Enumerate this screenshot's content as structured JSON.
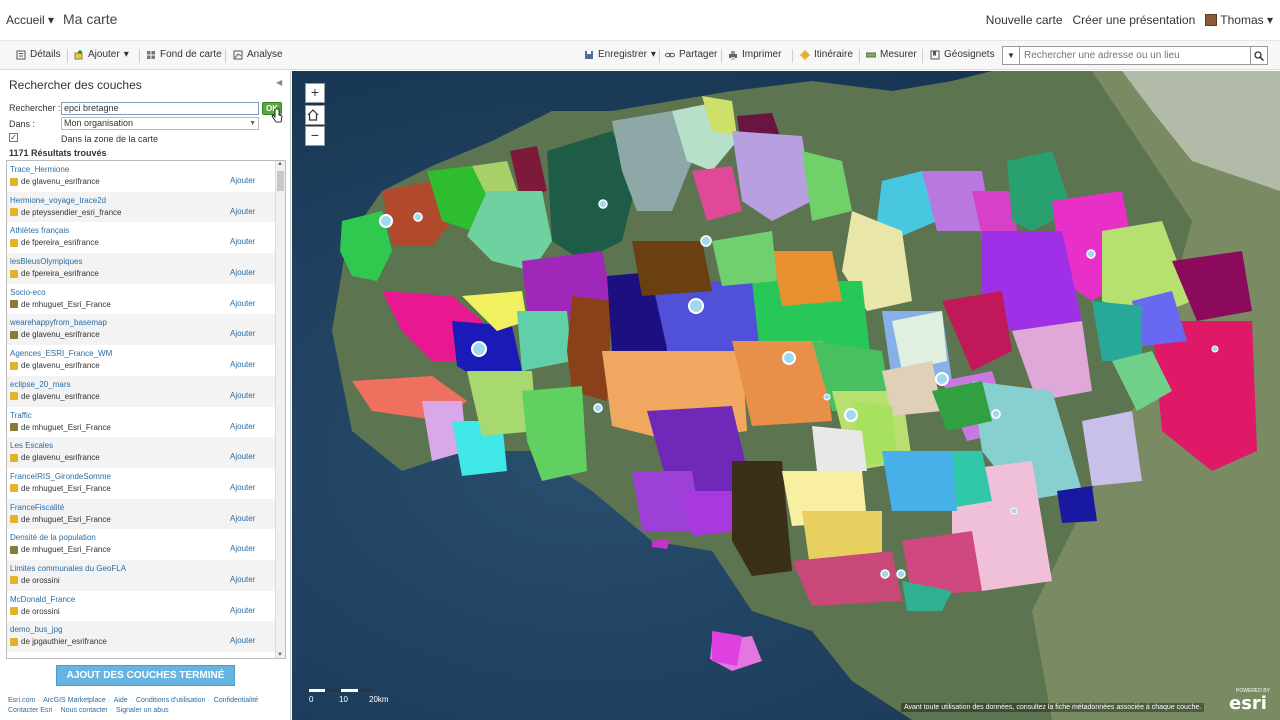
{
  "topnav": {
    "home": "Accueil",
    "map_title": "Ma carte",
    "new_map": "Nouvelle carte",
    "create_presentation": "Créer une présentation",
    "user": "Thomas"
  },
  "toolbar": {
    "details": "Détails",
    "add": "Ajouter",
    "basemap": "Fond de carte",
    "analysis": "Analyse",
    "save": "Enregistrer",
    "share": "Partager",
    "print": "Imprimer",
    "directions": "Itinéraire",
    "measure": "Mesurer",
    "bookmarks": "Géosignets",
    "search_placeholder": "Rechercher une adresse ou un lieu"
  },
  "panel": {
    "title": "Rechercher des couches",
    "search_label": "Rechercher :",
    "search_value": "epci bretagne",
    "ok": "OK",
    "in_label": "Dans :",
    "in_value": "Mon organisation",
    "extent_label": "Dans la zone de la carte",
    "results_count": "1171 Résultats trouvés",
    "add_label": "Ajouter",
    "results": [
      {
        "name": "Trace_Hermione",
        "owner": "de glavenu_esrifrance",
        "icon": "pin-icon"
      },
      {
        "name": "Hermione_voyage_trace2d",
        "owner": "de pteyssendier_esri_france",
        "icon": "pin-icon"
      },
      {
        "name": "Athlètes français",
        "owner": "de fpereira_esrifrance",
        "icon": "pin-icon"
      },
      {
        "name": "lesBleusOlympiques",
        "owner": "de fpereira_esrifrance",
        "icon": "pin-icon"
      },
      {
        "name": "Socio-eco",
        "owner": "de mhuguet_Esri_France",
        "icon": "map-icon"
      },
      {
        "name": "wearehappyfrom_basemap",
        "owner": "de glavenu_esrifrance",
        "icon": "map-icon"
      },
      {
        "name": "Agences_ESRI_France_WM",
        "owner": "de glavenu_esrifrance",
        "icon": "pin-icon"
      },
      {
        "name": "eclipse_20_mars",
        "owner": "de glavenu_esrifrance",
        "icon": "pin-icon"
      },
      {
        "name": "Traffic",
        "owner": "de mhuguet_Esri_France",
        "icon": "map-icon"
      },
      {
        "name": "Les Escales",
        "owner": "de glavenu_esrifrance",
        "icon": "pin-icon"
      },
      {
        "name": "FranceIRIS_GirondeSomme",
        "owner": "de mhuguet_Esri_France",
        "icon": "pin-icon"
      },
      {
        "name": "FranceFiscalité",
        "owner": "de mhuguet_Esri_France",
        "icon": "pin-icon"
      },
      {
        "name": "Densité de la population",
        "owner": "de mhuguet_Esri_France",
        "icon": "map-icon"
      },
      {
        "name": "Limites communales du GeoFLA",
        "owner": "de orossini",
        "icon": "pin-icon"
      },
      {
        "name": "McDonald_France",
        "owner": "de orossini",
        "icon": "pin-icon"
      },
      {
        "name": "demo_bus_jpg",
        "owner": "de jpgauthier_esrifrance",
        "icon": "pin-icon"
      }
    ],
    "done_button": "AJOUT DES COUCHES TERMINÉ",
    "footer": [
      "Esri.com",
      "ArcGIS Marketplace",
      "Aide",
      "Conditions d'utilisation",
      "Confidentialité",
      "Contacter Esri",
      "Nous contacter",
      "Signaler un abus"
    ]
  },
  "map": {
    "zoom_in": "+",
    "zoom_out": "−",
    "scale_labels": [
      "0",
      "10",
      "20km"
    ],
    "attribution": "Avant toute utilisation des données, consultez la fiche métadonnées associée à chaque couche.",
    "logo": "esri",
    "logo_small": "POWERED BY"
  }
}
